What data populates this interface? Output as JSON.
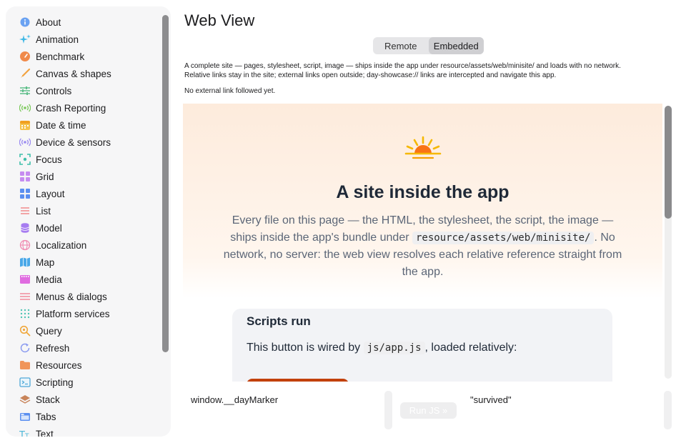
{
  "sidebar": {
    "items": [
      {
        "label": "About",
        "icon": "info-icon",
        "color": "#6aa2f2"
      },
      {
        "label": "Animation",
        "icon": "sparkles-icon",
        "color": "#3fb8e6"
      },
      {
        "label": "Benchmark",
        "icon": "gauge-icon",
        "color": "#f08a4b"
      },
      {
        "label": "Canvas & shapes",
        "icon": "brush-icon",
        "color": "#f2a340"
      },
      {
        "label": "Controls",
        "icon": "sliders-icon",
        "color": "#5fbf8a"
      },
      {
        "label": "Crash Reporting",
        "icon": "broadcast-icon",
        "color": "#7cc95c"
      },
      {
        "label": "Date & time",
        "icon": "calendar-icon",
        "color": "#f5c24b"
      },
      {
        "label": "Device & sensors",
        "icon": "sensor-icon",
        "color": "#9b8cf0"
      },
      {
        "label": "Focus",
        "icon": "focus-icon",
        "color": "#3fbfaa"
      },
      {
        "label": "Grid",
        "icon": "grid-icon",
        "color": "#c68cf0"
      },
      {
        "label": "Layout",
        "icon": "layout-icon",
        "color": "#5b8ff0"
      },
      {
        "label": "List",
        "icon": "list-icon",
        "color": "#f08a8a"
      },
      {
        "label": "Model",
        "icon": "database-icon",
        "color": "#a67cf0"
      },
      {
        "label": "Localization",
        "icon": "globe-icon",
        "color": "#f08ab0"
      },
      {
        "label": "Map",
        "icon": "map-icon",
        "color": "#4aa8e8"
      },
      {
        "label": "Media",
        "icon": "film-icon",
        "color": "#e06ce0"
      },
      {
        "label": "Menus & dialogs",
        "icon": "menu-icon",
        "color": "#f08a9a"
      },
      {
        "label": "Platform services",
        "icon": "dots-grid-icon",
        "color": "#4fc4b4"
      },
      {
        "label": "Query",
        "icon": "search-icon",
        "color": "#f0a83c"
      },
      {
        "label": "Refresh",
        "icon": "refresh-icon",
        "color": "#8a9af0"
      },
      {
        "label": "Resources",
        "icon": "folder-icon",
        "color": "#f0955a"
      },
      {
        "label": "Scripting",
        "icon": "terminal-icon",
        "color": "#4fa8d8"
      },
      {
        "label": "Stack",
        "icon": "stack-icon",
        "color": "#c8845a"
      },
      {
        "label": "Tabs",
        "icon": "tabs-icon",
        "color": "#5a8ff0"
      },
      {
        "label": "Text",
        "icon": "text-icon",
        "color": "#4fb8d8"
      }
    ]
  },
  "header": {
    "title": "Web View"
  },
  "segmented": {
    "options": [
      "Remote",
      "Embedded"
    ],
    "selected": "Embedded"
  },
  "description": {
    "line1": "A complete site — pages, stylesheet, script, image — ships inside the app under resource/assets/web/minisite/ and loads with no network.",
    "line2": "Relative links stay in the site; external links open outside; day-showcase:// links are intercepted and navigate this app."
  },
  "status_text": "No external link followed yet.",
  "webpage": {
    "title": "A site inside the app",
    "body_part1": "Every file on this page — the HTML, the stylesheet, the script, the image — ships inside the app's bundle under",
    "body_code": "resource/assets/web/minisite/",
    "body_part2": ". No network, no server: the web view resolves each relative reference straight from the app.",
    "card": {
      "heading": "Scripts run",
      "text_before": "This button is wired by",
      "text_code": "js/app.js",
      "text_after": ", loaded relatively:"
    }
  },
  "js_panel": {
    "expression": "window.__dayMarker",
    "run_label": "Run JS »",
    "result": "\"survived\""
  },
  "colors": {
    "accent": "#c2410c",
    "sun": "#f97316"
  }
}
